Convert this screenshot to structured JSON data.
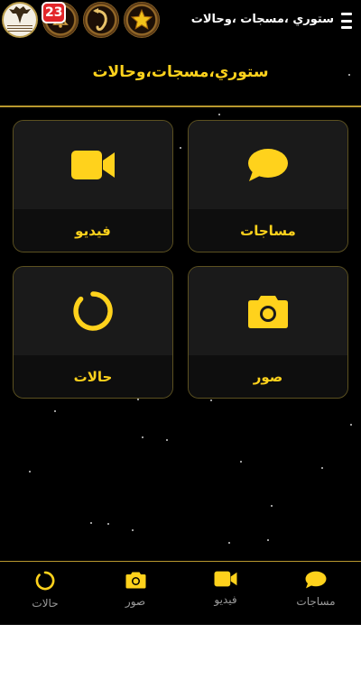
{
  "header": {
    "title": "ستوري ،مسجات ،وحالات",
    "notification_count": "23",
    "menu_icon": "hamburger-icon",
    "badges": [
      "channel-logo-icon",
      "bell-icon",
      "arrow-swirl-icon",
      "star-icon"
    ]
  },
  "page": {
    "title": "ستوري،مسجات،وحالات"
  },
  "grid": {
    "items": [
      {
        "label": "مساجات",
        "icon": "chat-bubble-icon"
      },
      {
        "label": "فيديو",
        "icon": "video-camera-icon"
      },
      {
        "label": "صور",
        "icon": "camera-icon"
      },
      {
        "label": "حالات",
        "icon": "status-ring-icon"
      }
    ]
  },
  "bottom_nav": {
    "items": [
      {
        "label": "مساجات",
        "icon": "chat-bubble-icon"
      },
      {
        "label": "فيديو",
        "icon": "video-camera-icon"
      },
      {
        "label": "صور",
        "icon": "camera-icon"
      },
      {
        "label": "حالات",
        "icon": "status-ring-icon"
      }
    ]
  },
  "colors": {
    "accent": "#ffd21c",
    "background": "#000000",
    "card": "#1a1a1a",
    "divider": "#b8982e",
    "nav_label": "#9a9a9a",
    "badge": "#e2262a"
  }
}
